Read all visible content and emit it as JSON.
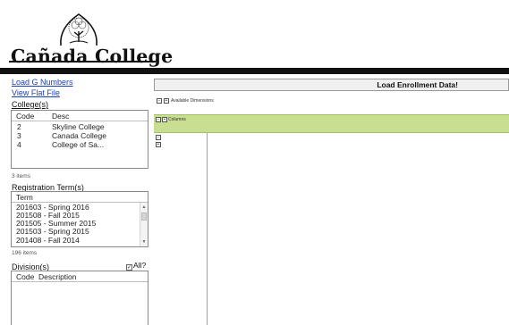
{
  "header": {
    "logo_text": "Cañada College",
    "logo_icon": "tree-emblem-icon"
  },
  "links": {
    "load_g_numbers": "Load G Numbers",
    "view_flat_file": "View Flat File"
  },
  "college": {
    "label": "College(s)",
    "columns": [
      "Code",
      "Desc"
    ],
    "rows": [
      {
        "code": "2",
        "desc": "Skyline College"
      },
      {
        "code": "3",
        "desc": "Canada College"
      },
      {
        "code": "4",
        "desc": "College of Sa..."
      }
    ],
    "count": "3 items"
  },
  "term": {
    "label": "Registration Term(s)",
    "column": "Term",
    "rows": [
      "201603 - Spring 2016",
      "201508 - Fall 2015",
      "201505 - Summer 2015",
      "201503 - Spring 2015",
      "201408 - Fall 2014"
    ],
    "count": "196 items"
  },
  "division": {
    "label": "Division(s)",
    "all_label": "All?",
    "all_checked": true,
    "columns": [
      "Code",
      "Description"
    ]
  },
  "pivot": {
    "load_button": "Load Enrollment Data!",
    "available_dimensions": "Available Dimensions",
    "columns_label": "Columns",
    "band_color": "#c8de90"
  }
}
